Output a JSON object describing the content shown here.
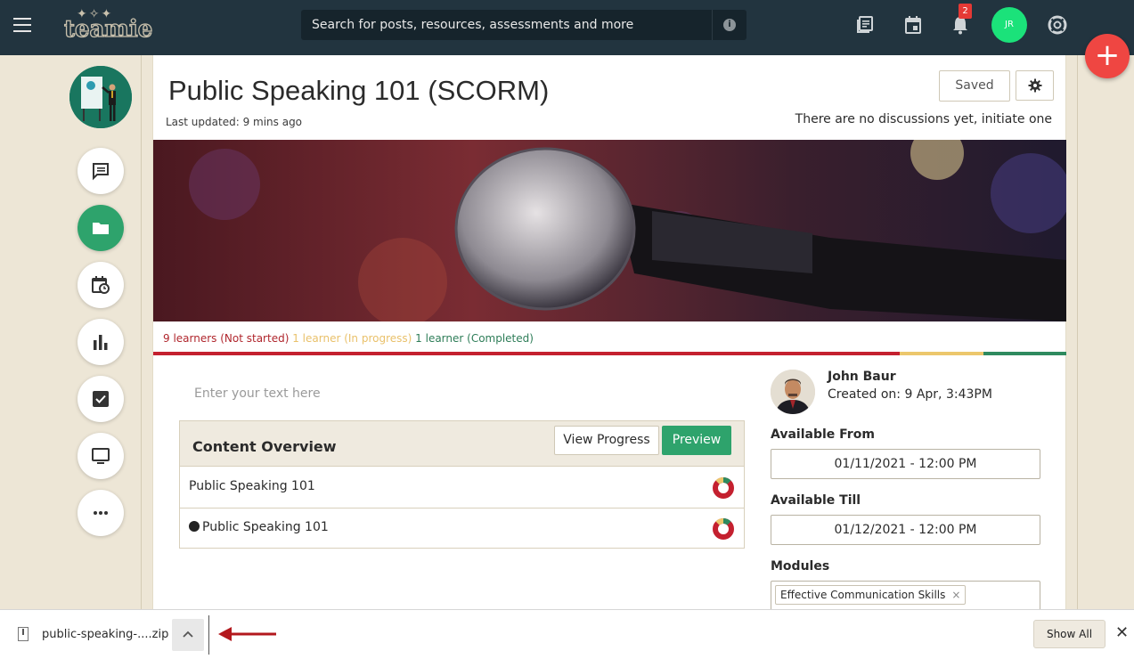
{
  "header": {
    "logo_text": "teamie",
    "search_placeholder": "Search for posts, resources, assessments and more",
    "notification_count": "2",
    "user_initials": "JR",
    "fab_label": "+"
  },
  "course": {
    "title": "Public Speaking 101 (SCORM)",
    "last_updated": "Last updated: 9 mins ago",
    "saved_label": "Saved",
    "discussion_text": "There are no discussions yet, initiate one"
  },
  "learners": {
    "not_started": "9 learners (Not started)",
    "in_progress": "1 learner (In progress)",
    "completed": "1 learner (Completed)",
    "fractions": {
      "not_started": 0.818,
      "in_progress": 0.091,
      "completed": 0.091
    },
    "colors": {
      "not_started": "#c4202f",
      "in_progress": "#ecc76c",
      "completed": "#2e8a5f"
    }
  },
  "editor": {
    "placeholder": "Enter your text here"
  },
  "content_overview": {
    "title": "Content Overview",
    "view_progress_label": "View Progress",
    "preview_label": "Preview",
    "rows": [
      {
        "label": "Public Speaking 101"
      },
      {
        "label": "Public Speaking 101"
      }
    ]
  },
  "author": {
    "name": "John Baur",
    "created_on": "Created on: 9 Apr, 3:43PM"
  },
  "availability": {
    "from_label": "Available From",
    "from_value": "01/11/2021 - 12:00 PM",
    "till_label": "Available Till",
    "till_value": "01/12/2021 - 12:00 PM",
    "modules_label": "Modules",
    "module_tag": "Effective Communication Skills",
    "module_tag_remove": "×"
  },
  "download_bar": {
    "file_name": "public-speaking-....zip",
    "show_all_label": "Show All",
    "close_label": "✕"
  },
  "colors": {
    "topbar": "#22343f",
    "accent_green": "#2ea36c",
    "fab_red": "#ef4642",
    "page_bg": "#ede6d6"
  }
}
